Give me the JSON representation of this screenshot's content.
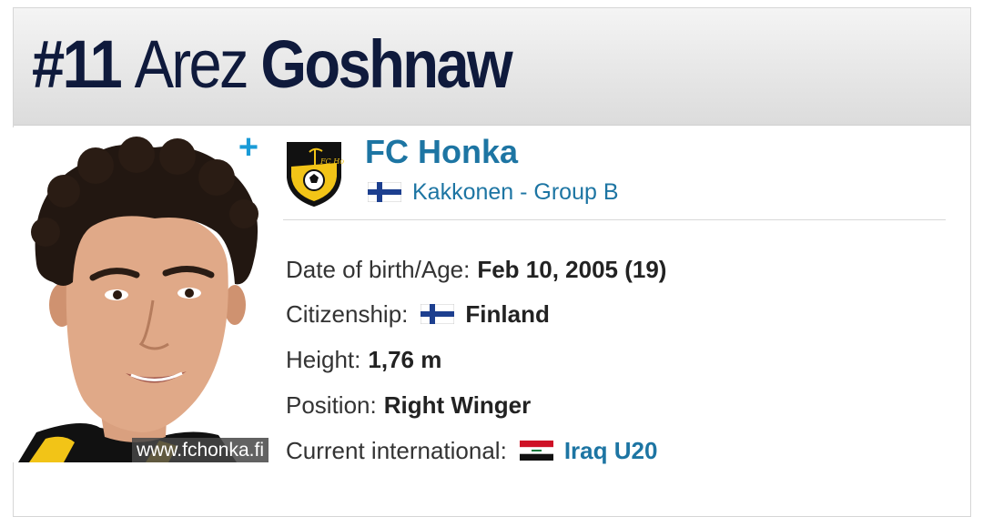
{
  "player": {
    "number": "#11",
    "first_name": "Arez",
    "last_name": "Goshnaw"
  },
  "photo": {
    "watermark": "www.fchonka.fi"
  },
  "actions": {
    "add_icon": "plus-icon"
  },
  "club": {
    "name": "FC Honka",
    "logo_icon": "fc-honka-crest",
    "logo_text": "FC Honka",
    "league_flag": "finland-flag",
    "league": "Kakkonen - Group B"
  },
  "details": {
    "dob_label": "Date of birth/Age:",
    "dob_value": "Feb 10, 2005 (19)",
    "citizenship_label": "Citizenship:",
    "citizenship_flag": "finland-flag",
    "citizenship_value": "Finland",
    "height_label": "Height:",
    "height_value": "1,76 m",
    "position_label": "Position:",
    "position_value": "Right Winger",
    "international_label": "Current international:",
    "international_flag": "iraq-flag",
    "international_value": "Iraq U20"
  },
  "colors": {
    "title": "#0f1a3c",
    "link": "#1d75a3",
    "plus": "#1a9bd7",
    "crest_yellow": "#f2c417"
  }
}
